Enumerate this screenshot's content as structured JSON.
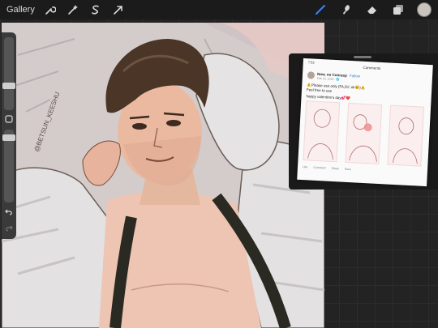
{
  "toolbar": {
    "gallery_label": "Gallery",
    "left_icons": [
      "wrench-icon",
      "magic-wand-icon",
      "selection-icon",
      "transform-arrow-icon"
    ],
    "right_icons": [
      "brush-icon",
      "smudge-icon",
      "eraser-icon",
      "layers-icon"
    ],
    "active_color": "#c9c3bd",
    "brush_color": "#3b82f6"
  },
  "reference": {
    "status_time": "7:53",
    "header": "Comments",
    "username": "Now, no Conrasp",
    "follow_label": "Follow",
    "date": "Feb 15, 2019 · 🌐",
    "line1": "⚠️Please use only (FA,DC ok😄)⚠️",
    "line2": "Feel free to use",
    "line3": "happy valentine's day💕❤️",
    "actions": "Like Comment Share Save"
  },
  "artwork": {
    "signature": "@BETSUN_KEESHU"
  }
}
